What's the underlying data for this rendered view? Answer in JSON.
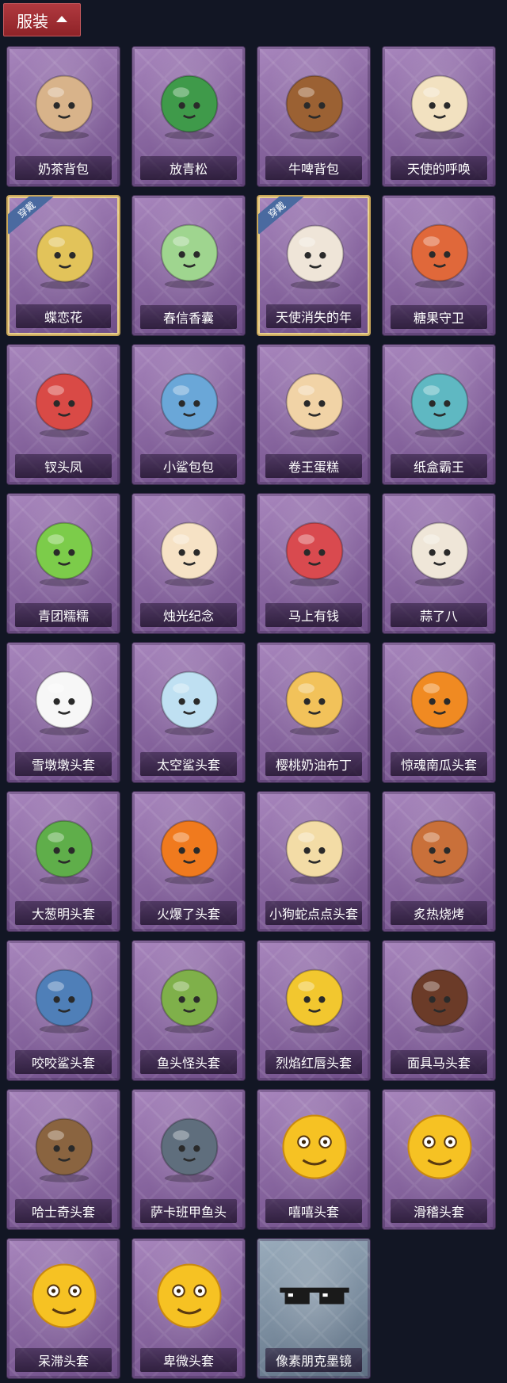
{
  "header": {
    "title": "服装"
  },
  "items": [
    {
      "name": "奶茶背包",
      "icon": "milk-tea-backpack-icon",
      "color": "#d8b38a",
      "equipped": false
    },
    {
      "name": "放青松",
      "icon": "pine-tree-pot-icon",
      "color": "#3f9a4a",
      "equipped": false
    },
    {
      "name": "牛啤背包",
      "icon": "cow-beer-barrel-icon",
      "color": "#9b6133",
      "equipped": false
    },
    {
      "name": "天使的呼唤",
      "icon": "angel-figure-icon",
      "color": "#f2e1c0",
      "equipped": false
    },
    {
      "name": "蝶恋花",
      "icon": "butterfly-charm-icon",
      "color": "#e2c35a",
      "equipped": true,
      "tag": "穿戴"
    },
    {
      "name": "春信香囊",
      "icon": "sachet-icon",
      "color": "#9fd58f",
      "equipped": false
    },
    {
      "name": "天使消失的年",
      "icon": "angel-girl-charm-icon",
      "color": "#efe5d8",
      "equipped": true,
      "tag": "穿戴"
    },
    {
      "name": "糖果守卫",
      "icon": "pumpkin-scarecrow-icon",
      "color": "#e0683a",
      "equipped": false
    },
    {
      "name": "钗头凤",
      "icon": "phoenix-crown-doll-icon",
      "color": "#d94a46",
      "equipped": false
    },
    {
      "name": "小鲨包包",
      "icon": "shark-bag-icon",
      "color": "#6aa7d8",
      "equipped": false
    },
    {
      "name": "卷王蛋糕",
      "icon": "roll-cake-icon",
      "color": "#f1d3a6",
      "equipped": false
    },
    {
      "name": "纸盒霸王",
      "icon": "box-dinosaur-icon",
      "color": "#5fb8c2",
      "equipped": false
    },
    {
      "name": "青团糯糯",
      "icon": "green-dumpling-icon",
      "color": "#7ccc4a",
      "equipped": false
    },
    {
      "name": "烛光纪念",
      "icon": "candle-icon",
      "color": "#f6e2c5",
      "equipped": false
    },
    {
      "name": "马上有钱",
      "icon": "red-horse-icon",
      "color": "#d94a4f",
      "equipped": false
    },
    {
      "name": "蒜了八",
      "icon": "garlic-icon",
      "color": "#efe6d8",
      "equipped": false
    },
    {
      "name": "雪墩墩头套",
      "icon": "snowman-head-icon",
      "color": "#f7f7f7",
      "equipped": false
    },
    {
      "name": "太空鲨头套",
      "icon": "space-shark-head-icon",
      "color": "#bfe0f2",
      "equipped": false
    },
    {
      "name": "樱桃奶油布丁",
      "icon": "pudding-head-icon",
      "color": "#f2c25a",
      "equipped": false
    },
    {
      "name": "惊魂南瓜头套",
      "icon": "jack-o-lantern-icon",
      "color": "#f08a22",
      "equipped": false
    },
    {
      "name": "大葱明头套",
      "icon": "green-onion-head-icon",
      "color": "#5fae4a",
      "equipped": false
    },
    {
      "name": "火爆了头套",
      "icon": "fire-head-icon",
      "color": "#f07a1e",
      "equipped": false
    },
    {
      "name": "小狗蛇点点头套",
      "icon": "snake-head-icon",
      "color": "#f3dca6",
      "equipped": false
    },
    {
      "name": "炙热烧烤",
      "icon": "bbq-meat-icon",
      "color": "#c9703a",
      "equipped": false
    },
    {
      "name": "咬咬鲨头套",
      "icon": "biting-shark-icon",
      "color": "#4f7fb8",
      "equipped": false
    },
    {
      "name": "鱼头怪头套",
      "icon": "fish-monster-head-icon",
      "color": "#7fb04a",
      "equipped": false
    },
    {
      "name": "烈焰红唇头套",
      "icon": "yellow-mascot-head-icon",
      "color": "#f2c72f",
      "equipped": false
    },
    {
      "name": "面具马头套",
      "icon": "horse-mask-icon",
      "color": "#6b3b28",
      "equipped": false
    },
    {
      "name": "哈士奇头套",
      "icon": "husky-head-icon",
      "color": "#8a6440",
      "equipped": false
    },
    {
      "name": "萨卡班甲鱼头",
      "icon": "sacabambaspis-head-icon",
      "color": "#5f6e7d",
      "equipped": false
    },
    {
      "name": "嘻嘻头套",
      "icon": "grinning-face-icon",
      "color": "#f6c223",
      "equipped": false
    },
    {
      "name": "滑稽头套",
      "icon": "funny-face-icon",
      "color": "#f6c223",
      "equipped": false
    },
    {
      "name": "呆滞头套",
      "icon": "dazed-face-icon",
      "color": "#f6c223",
      "equipped": false
    },
    {
      "name": "卑微头套",
      "icon": "humble-face-icon",
      "color": "#f6c223",
      "equipped": false
    },
    {
      "name": "像素朋克墨镜",
      "icon": "pixel-sunglasses-icon",
      "color": "#1a1a1a",
      "equipped": false,
      "grey": true
    }
  ]
}
